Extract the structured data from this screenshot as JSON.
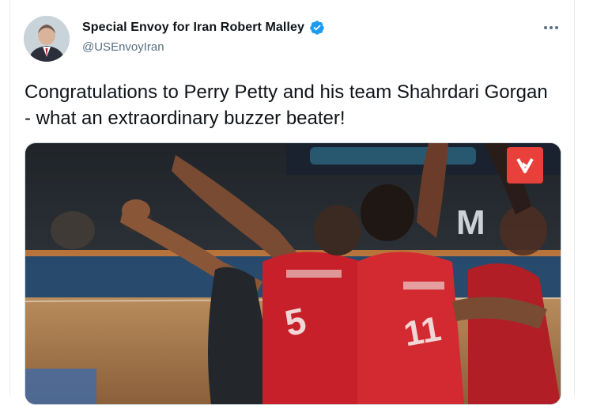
{
  "tweet": {
    "display_name": "Special Envoy for Iran Robert Malley",
    "handle": "@USEnvoyIran",
    "text": "Congratulations to Perry Petty and his team Shahrdari Gorgan - what an extraordinary buzzer beater!"
  },
  "icons": {
    "verified": "verified-badge-icon",
    "more": "more-options-icon",
    "broadcaster": "broadcaster-logo-icon"
  },
  "colors": {
    "verified": "#1d9bf0",
    "jersey": "#c8202a",
    "badge": "#e8403a"
  }
}
